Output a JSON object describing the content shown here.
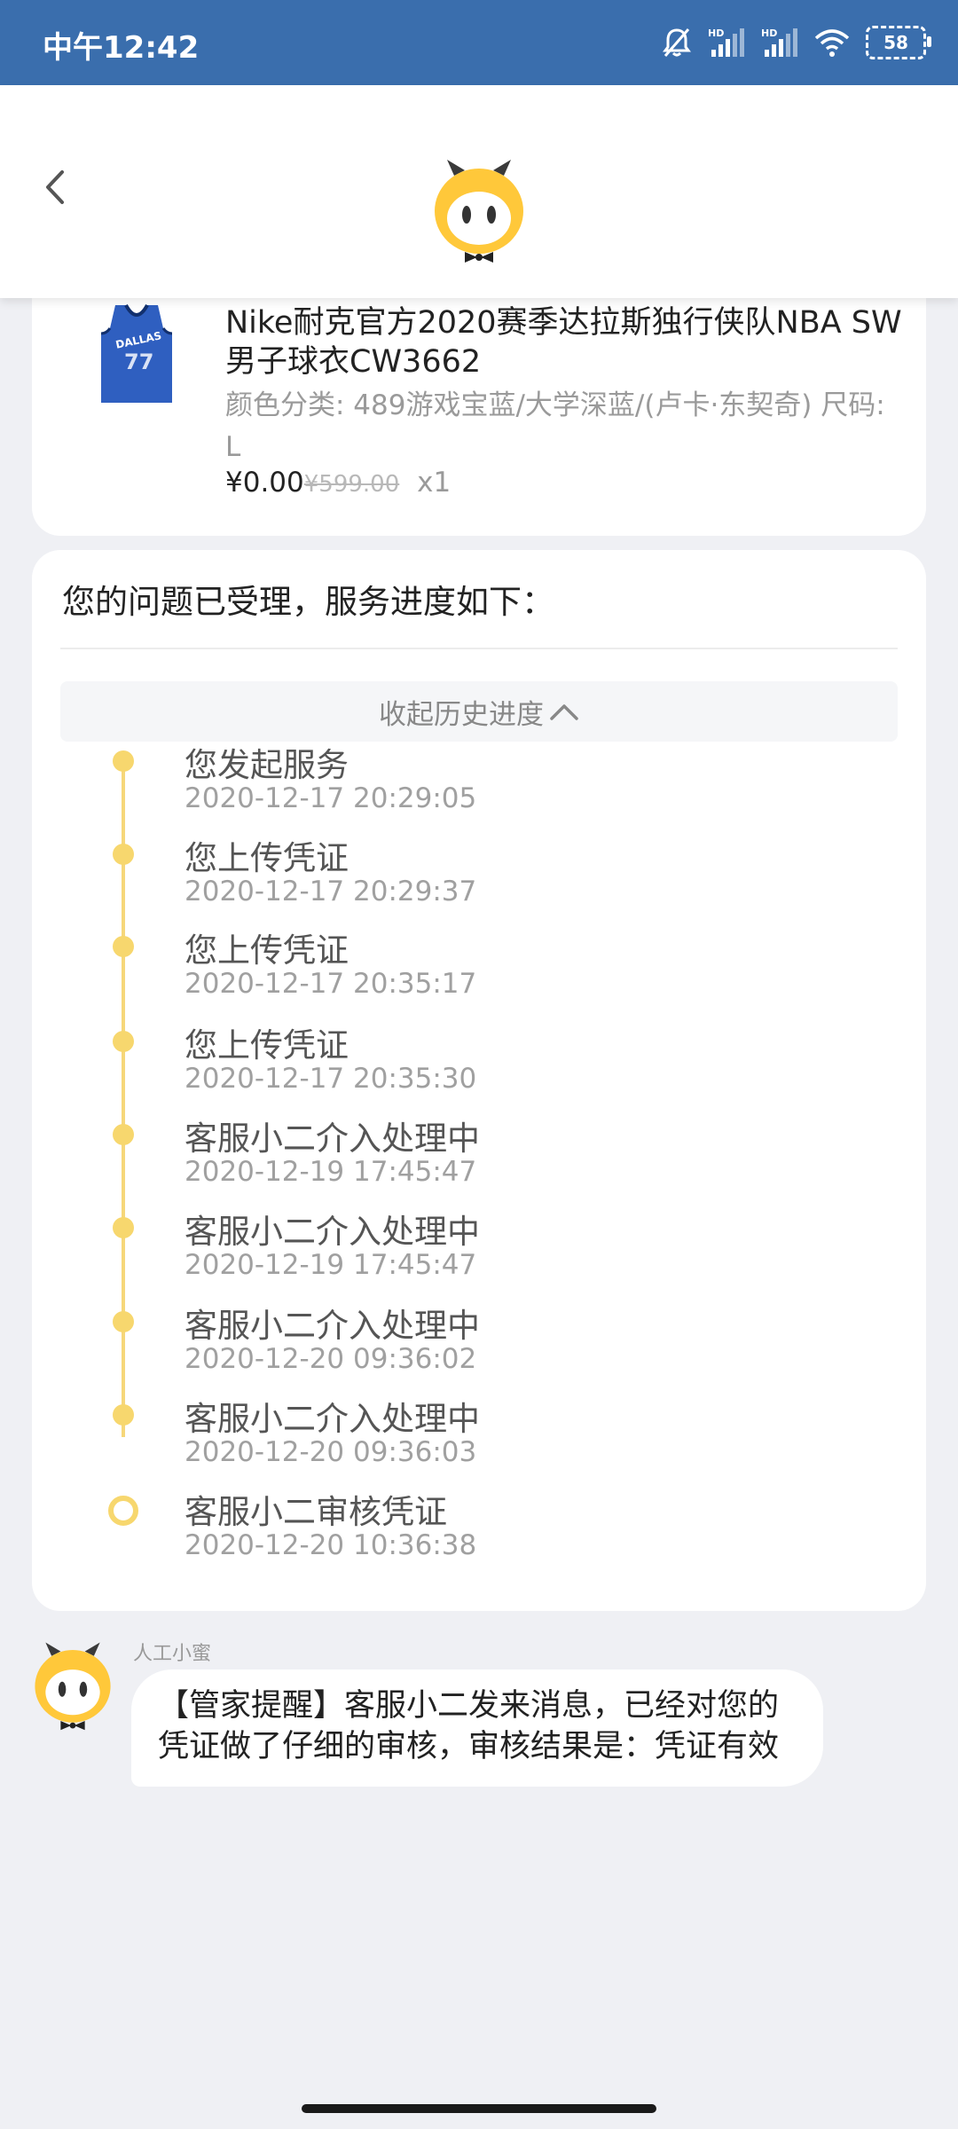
{
  "status_bar": {
    "time": "中午12:42",
    "battery": "58",
    "icons": [
      "bell-off-icon",
      "signal-hd-icon",
      "signal-hd-icon",
      "wifi-icon",
      "battery-icon"
    ]
  },
  "header": {
    "back_icon": "chevron-left-icon",
    "logo": "mascot-logo"
  },
  "product": {
    "title": "Nike耐克官方2020赛季达拉斯独行侠队NBA SW男子球衣CW3662",
    "spec": "颜色分类: 489游戏宝蓝/大学深蓝/(卢卡·东契奇) 尺码: L",
    "price": "¥0.00",
    "original_price": "¥599.00",
    "quantity": "x1"
  },
  "progress": {
    "heading": "您的问题已受理，服务进度如下：",
    "collapse_label": "收起历史进度",
    "items": [
      {
        "title": "您发起服务",
        "time": "2020-12-17 20:29:05"
      },
      {
        "title": "您上传凭证",
        "time": "2020-12-17 20:29:37"
      },
      {
        "title": "您上传凭证",
        "time": "2020-12-17 20:35:17"
      },
      {
        "title": "您上传凭证",
        "time": "2020-12-17 20:35:30"
      },
      {
        "title": "客服小二介入处理中",
        "time": "2020-12-19 17:45:47"
      },
      {
        "title": "客服小二介入处理中",
        "time": "2020-12-19 17:45:47"
      },
      {
        "title": "客服小二介入处理中",
        "time": "2020-12-20 09:36:02"
      },
      {
        "title": "客服小二介入处理中",
        "time": "2020-12-20 09:36:03"
      },
      {
        "title": "客服小二审核凭证",
        "time": "2020-12-20 10:36:38"
      }
    ]
  },
  "chat": {
    "sender": "人工小蜜",
    "message": "【管家提醒】客服小二发来消息，已经对您的凭证做了仔细的审核，审核结果是：凭证有效"
  },
  "colors": {
    "status_bar": "#3a6ead",
    "background": "#eff0f4",
    "timeline": "#f7d76e",
    "mascot": "#ffc83a"
  }
}
